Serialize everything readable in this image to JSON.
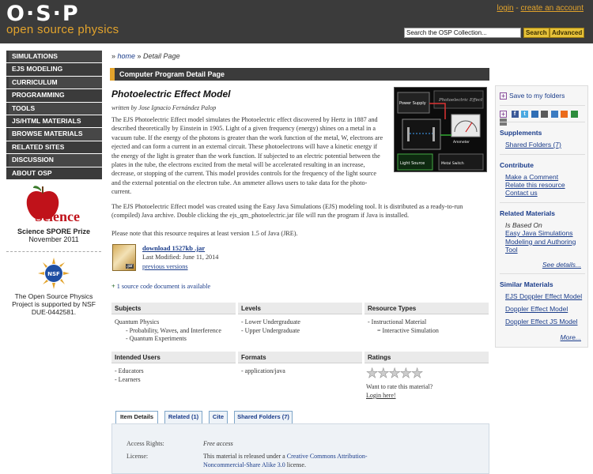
{
  "header": {
    "logo_text": "O·S·P",
    "tagline": "open source physics",
    "login": "login",
    "separator": " - ",
    "create_account": "create an account",
    "search_placeholder": "Search the OSP Collection...",
    "search_button": "Search",
    "advanced_button": "Advanced"
  },
  "nav": {
    "items": [
      "SIMULATIONS",
      "EJS MODELING",
      "CURRICULUM",
      "PROGRAMMING",
      "TOOLS",
      "JS/HTML MATERIALS",
      "BROWSE MATERIALS",
      "RELATED SITES",
      "DISCUSSION",
      "ABOUT OSP"
    ]
  },
  "science": {
    "logo_word": "Science",
    "prize": "Science SPORE Prize",
    "date": "November 2011"
  },
  "nsf": {
    "logo_text": "NSF",
    "text": "The Open Source Physics Project is supported by NSF DUE-0442581."
  },
  "breadcrumb": {
    "prefix": "» ",
    "home": "home",
    "sep": " » ",
    "current": "Detail Page"
  },
  "detail_bar": "Computer Program Detail Page",
  "resource": {
    "title": "Photoelectric Effect Model",
    "author": "written by Jose Ignacio Fernández Palop",
    "description": "The EJS Photoelectric Effect model simulates the Photoelectric effect discovered by Hertz in 1887 and described theoretically by Einstein in 1905. Light of a given frequency (energy) shines on a metal in a vacuum tube. If the energy of the photons is greater than the work function of the metal, W, electrons are ejected and can form a current in an external circuit. These photoelectrons will have a kinetic energy if the energy of the light is greater than the work function. If subjected to an electric potential between the plates in the tube, the electrons excited from the metal will be accelerated resulting in an increase, decrease, or stopping of the current. This model provides controls for the frequency of the light source and the external potential on the electron tube. An ammeter allows users to take data for the photo-current.",
    "description2": "The EJS Photoelectric Effect model was created using the Easy Java Simulations (EJS) modeling tool.  It is distributed as a ready-to-run (compiled) Java archive.  Double clicking the ejs_qm_photoelectric.jar file will run the program if Java is installed.",
    "description3": "Please note that this resource requires at least version 1.5 of Java (JRE).",
    "thumb_labels": {
      "power_supply": "Power Supply",
      "light_source": "Light Source",
      "metal_switch": "Metal Switch",
      "title_top": "Photoelectric Effect",
      "ammeter": "Ammeter"
    },
    "jar_label": ".jar",
    "download": "download 1527kb .jar",
    "last_modified": "Last Modified: June 11, 2014",
    "previous_versions": "previous versions",
    "source_doc_plus": "+",
    "source_doc": " 1 source code document is available"
  },
  "metadata": {
    "subjects_head": "Subjects",
    "subjects": [
      "Quantum Physics",
      "- Probability, Waves, and Interference",
      "- Quantum Experiments"
    ],
    "levels_head": "Levels",
    "levels": [
      "- Lower Undergraduate",
      "- Upper Undergraduate"
    ],
    "types_head": "Resource Types",
    "types": [
      "- Instructional Material",
      "= Interactive Simulation"
    ],
    "users_head": "Intended Users",
    "users": [
      "- Educators",
      "- Learners"
    ],
    "formats_head": "Formats",
    "formats": [
      "- application/java"
    ],
    "ratings_head": "Ratings",
    "rating_stars": 0,
    "rating_max": 5,
    "rate_prompt": "Want to rate this material?",
    "login_here": "Login here!"
  },
  "tabs": [
    "Item Details",
    "Related (1)",
    "Cite",
    "Shared Folders (7)"
  ],
  "item_details": {
    "access_label": "Access Rights:",
    "access_value": "Free access",
    "license_label": "License:",
    "license_pre": "This material is released under a ",
    "license_link": "Creative Commons Attribution-Noncommercial-Share Alike 3.0",
    "license_post": " license."
  },
  "rightcol": {
    "save_plus": "+",
    "save": "Save to my folders",
    "supplements_head": "Supplements",
    "shared_folders": "Shared Folders (7)",
    "contribute_head": "Contribute",
    "make_comment": "Make a Comment",
    "relate": "Relate this resource",
    "contact": "Contact us",
    "related_head": "Related Materials",
    "is_based_on": "Is Based On",
    "based_on_link": "Easy Java Simulations Modeling and Authoring Tool",
    "see_details": "See details...",
    "similar_head": "Similar Materials",
    "similar": [
      "EJS Doppler Effect Model",
      "Doppler Effect Model",
      "Doppler Effect JS Model"
    ],
    "more": "More..."
  },
  "colors": {
    "header_bg": "#3b3b3b",
    "accent": "#e2a32c",
    "link": "#1a3c8a",
    "science_red": "#c0121a"
  }
}
